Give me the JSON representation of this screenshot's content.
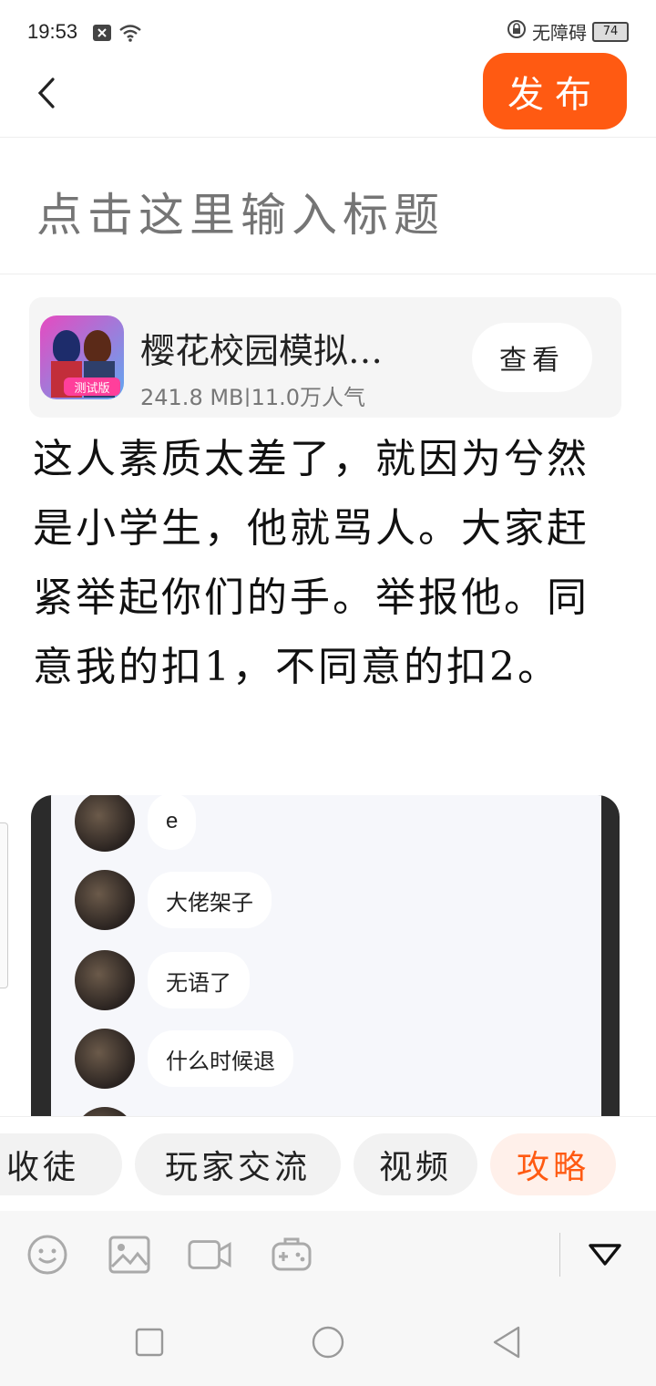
{
  "status_bar": {
    "time": "19:53",
    "accessibility_label": "无障碍",
    "battery": "74"
  },
  "header": {
    "publish_label": "发布"
  },
  "title_input": {
    "placeholder": "点击这里输入标题"
  },
  "game_card": {
    "name": "樱花校园模拟…",
    "meta": "241.8 MB|11.0万人气",
    "icon_badge": "测试版",
    "view_label": "查看"
  },
  "body_text": "这人素质太差了，就因为兮然是小学生，他就骂人。大家赶紧举起你们的手。举报他。同意我的扣1，不同意的扣2。",
  "screenshot_messages": [
    {
      "text": "e"
    },
    {
      "text": "大佬架子"
    },
    {
      "text": "无语了"
    },
    {
      "text": "什么时候退"
    }
  ],
  "tags": [
    {
      "label": "收徒"
    },
    {
      "label": "玩家交流"
    },
    {
      "label": "视频"
    },
    {
      "label": "攻略",
      "active": true
    }
  ],
  "toolbar_icons": [
    "emoji-icon",
    "image-icon",
    "video-icon",
    "gamepad-icon",
    "collapse-down-icon"
  ],
  "colors": {
    "accent": "#ff5a12",
    "active_tag_bg": "#fff0ea"
  }
}
